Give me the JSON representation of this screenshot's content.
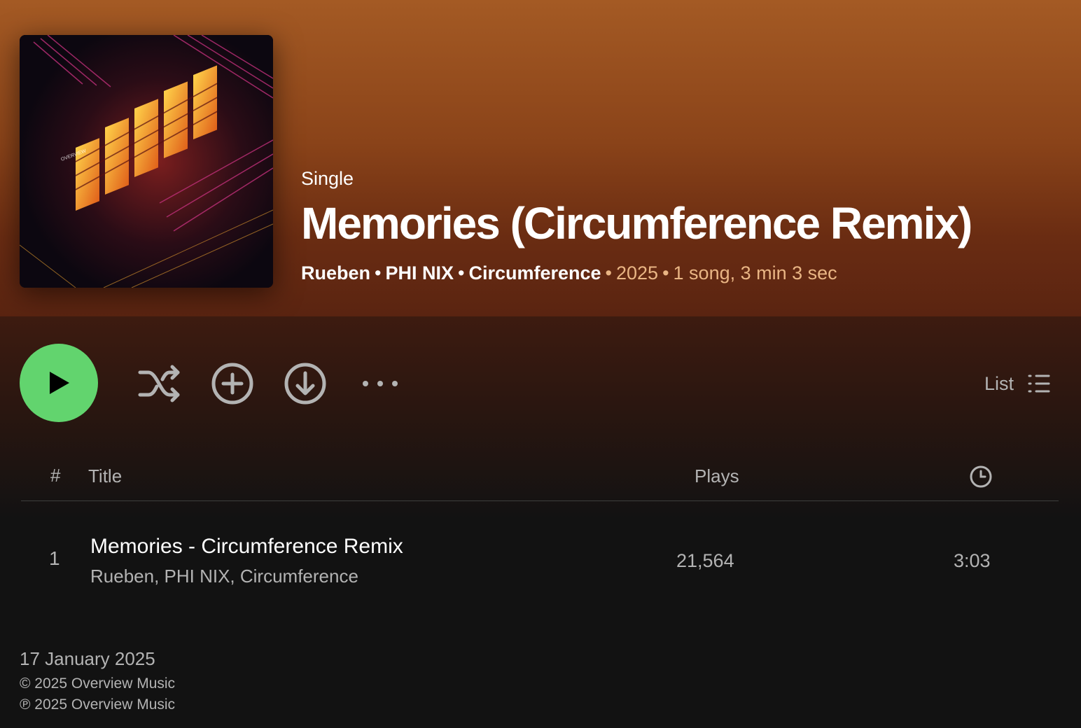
{
  "album": {
    "type_label": "Single",
    "title": "Memories (Circumference Remix)",
    "artists": [
      "Rueben",
      "PHI NIX",
      "Circumference"
    ],
    "year": "2025",
    "summary": "1 song, 3 min 3 sec",
    "separator": "•"
  },
  "controls": {
    "play_icon": "play-icon",
    "shuffle_icon": "shuffle-icon",
    "add_icon": "add-circle-icon",
    "download_icon": "download-icon",
    "more_icon": "more-icon",
    "view_label": "List",
    "view_icon": "list-icon",
    "accent": "#62d46e"
  },
  "table": {
    "headers": {
      "number": "#",
      "title": "Title",
      "plays": "Plays",
      "duration_icon": "clock-icon"
    },
    "rows": [
      {
        "number": "1",
        "title": "Memories - Circumference Remix",
        "artists": "Rueben, PHI NIX, Circumference",
        "plays": "21,564",
        "duration": "3:03"
      }
    ]
  },
  "footer": {
    "release_date": "17 January 2025",
    "copyright": "© 2025 Overview Music",
    "phonographic": "℗ 2025 Overview Music"
  },
  "colors": {
    "header_top": "#a45a24",
    "header_bottom": "#5a2411",
    "background": "#121212",
    "muted_text": "#b3b3b3",
    "meta_text": "#e9b584"
  }
}
